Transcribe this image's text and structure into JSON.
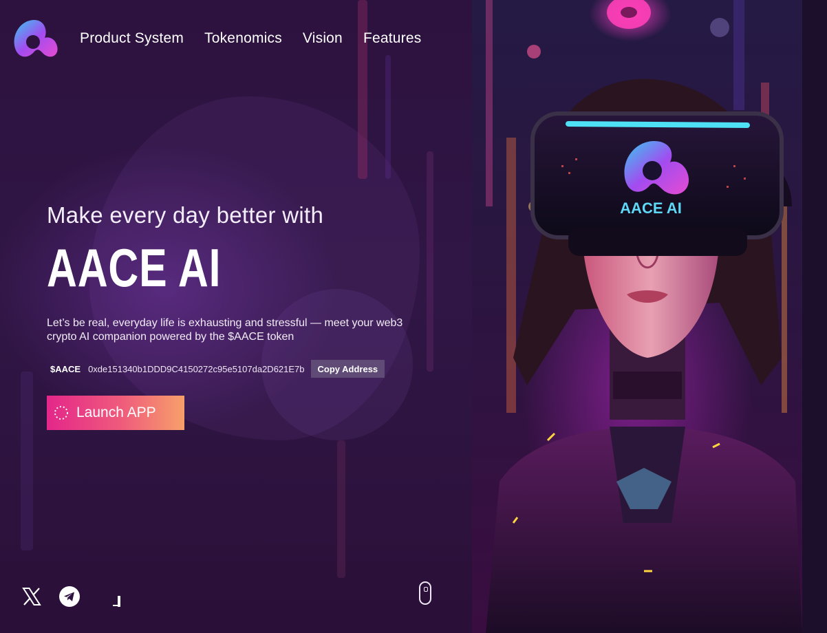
{
  "nav": {
    "items": [
      "Product System",
      "Tokenomics",
      "Vision",
      "Features"
    ]
  },
  "hero": {
    "tagline": "Make every day better with",
    "brand": "AACE AI",
    "description": "Let’s be real, everyday life is exhausting and stressful — meet your web3 crypto AI companion powered by the $AACE token",
    "token_symbol": "$AACE",
    "token_address": "0xde151340b1DDD9C4150272c95e5107da2D621E7b",
    "copy_label": "Copy Address",
    "launch_label": "Launch APP"
  },
  "visor": {
    "label": "AACE AI"
  },
  "social": [
    "x-icon",
    "telegram-icon"
  ],
  "colors": {
    "background": "#2d123f",
    "launch_gradient_start": "#e4268a",
    "launch_gradient_end": "#f7a06a",
    "logo_cyan": "#37c9f0",
    "logo_violet": "#a24cf0",
    "logo_pink": "#e64bd2"
  }
}
